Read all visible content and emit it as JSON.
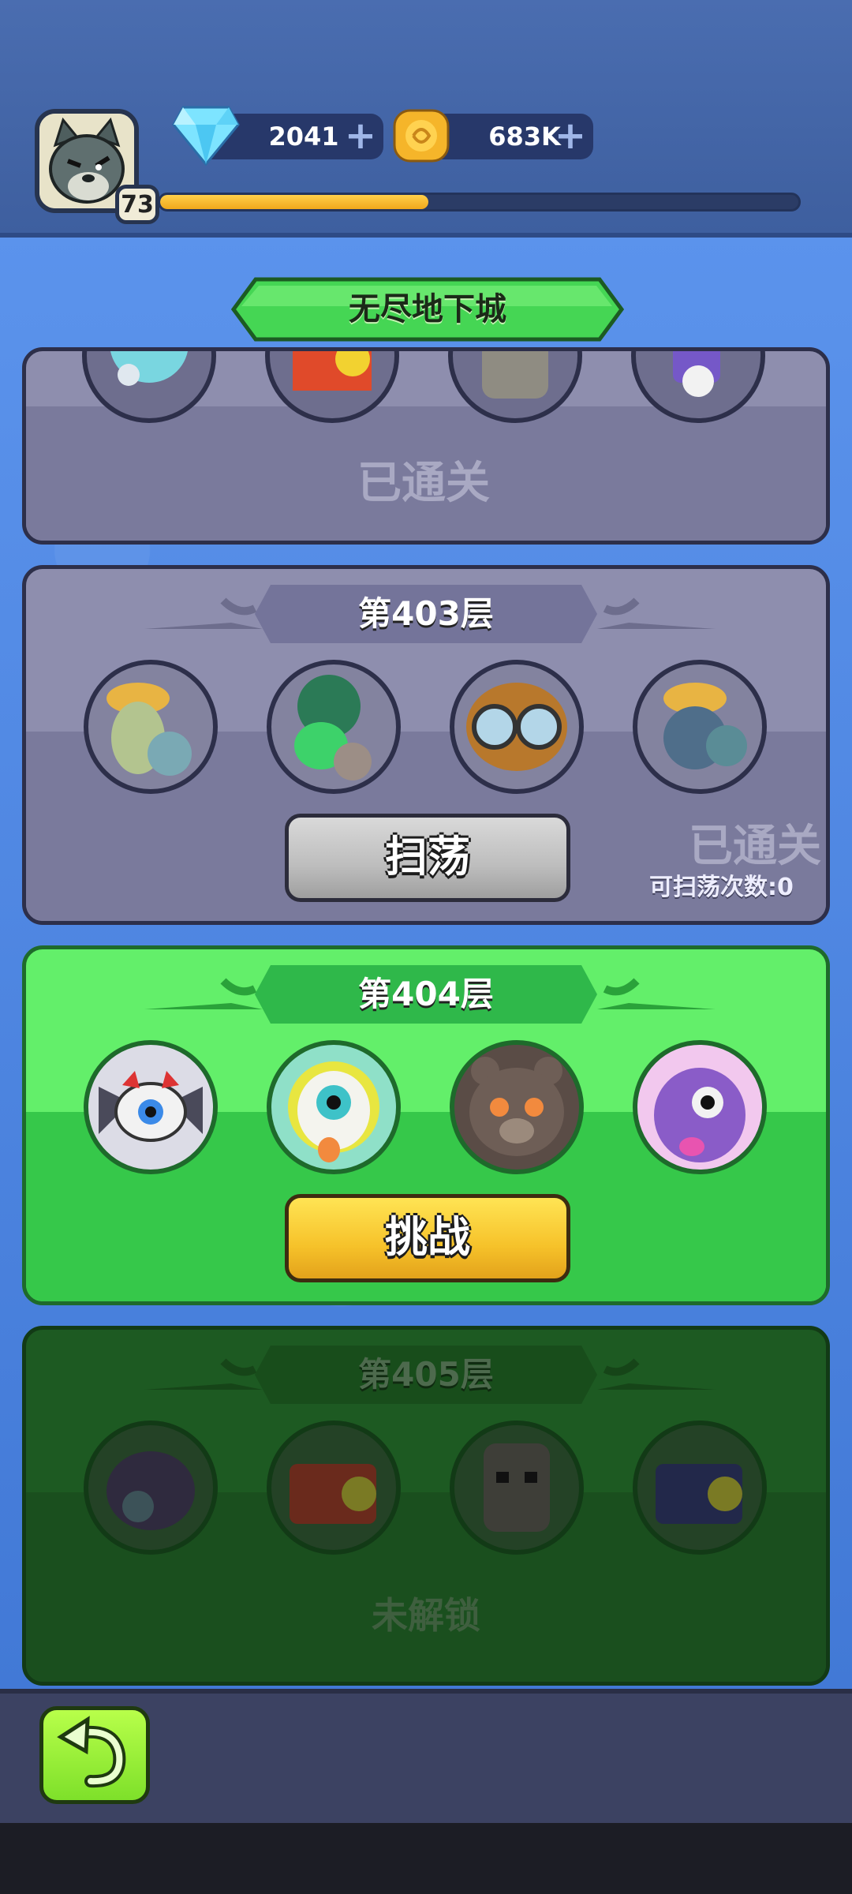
{
  "player": {
    "level": "73",
    "xp_progress": 0.42
  },
  "currencies": {
    "gems": "2041",
    "gold": "683K"
  },
  "header": {
    "title": "无尽地下城"
  },
  "floors": [
    {
      "floor_label": "",
      "status": "已通关",
      "state": "cleared"
    },
    {
      "floor_label": "第403层",
      "status": "已通关",
      "sweep_count": "可扫荡次数:0",
      "button": "扫荡",
      "state": "cleared"
    },
    {
      "floor_label": "第404层",
      "button": "挑战",
      "state": "active"
    },
    {
      "floor_label": "第405层",
      "status": "未解锁",
      "state": "locked"
    }
  ],
  "icons": {
    "gem": "diamond-icon",
    "gold": "gold-coin-icon",
    "plus": "plus-icon",
    "back": "back-arrow-icon"
  },
  "colors": {
    "cleared_panel": "#8e8eae",
    "active_panel": "#63ef6a",
    "locked_panel": "#1d5a22",
    "challenge_button": "#f6c22a"
  }
}
